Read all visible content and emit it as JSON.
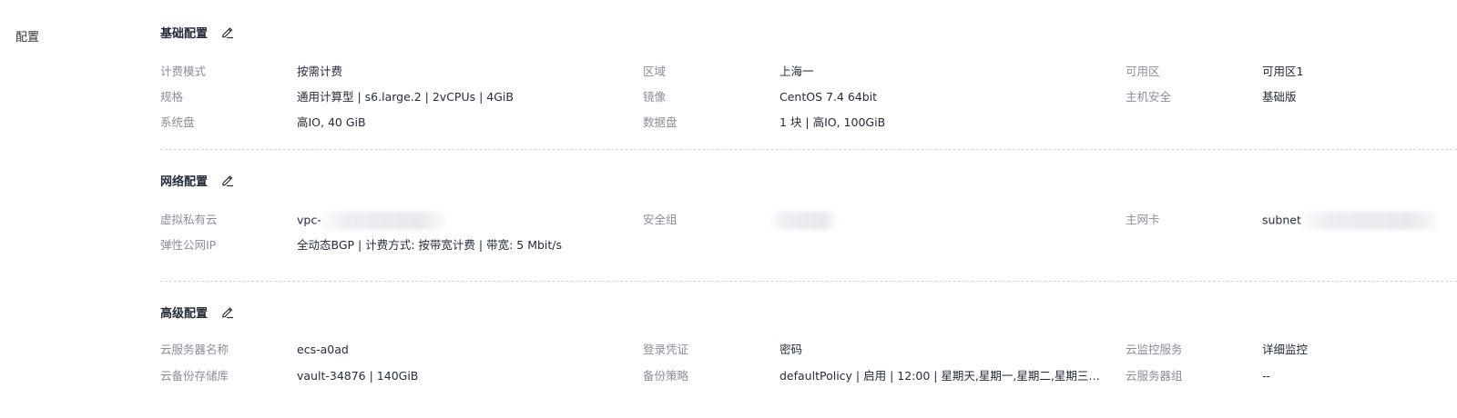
{
  "page_title": "配置",
  "sections": {
    "basic": {
      "title": "基础配置",
      "rows": [
        [
          {
            "label": "计费模式",
            "value": "按需计费"
          },
          {
            "label": "区域",
            "value": "上海一"
          },
          {
            "label": "可用区",
            "value": "可用区1"
          }
        ],
        [
          {
            "label": "规格",
            "value": "通用计算型 | s6.large.2 | 2vCPUs | 4GiB"
          },
          {
            "label": "镜像",
            "value": "CentOS 7.4 64bit"
          },
          {
            "label": "主机安全",
            "value": "基础版"
          }
        ],
        [
          {
            "label": "系统盘",
            "value": "高IO, 40 GiB"
          },
          {
            "label": "数据盘",
            "value": "1 块 | 高IO, 100GiB"
          }
        ]
      ]
    },
    "network": {
      "title": "网络配置",
      "rows": [
        [
          {
            "label": "虚拟私有云",
            "value": "vpc-"
          },
          {
            "label": "安全组",
            "value": ""
          },
          {
            "label": "主网卡",
            "value": "subnet"
          }
        ],
        [
          {
            "label": "弹性公网IP",
            "value": "全动态BGP |  计费方式: 按带宽计费 |  带宽: 5 Mbit/s"
          }
        ]
      ]
    },
    "advanced": {
      "title": "高级配置",
      "rows": [
        [
          {
            "label": "云服务器名称",
            "value": "ecs-a0ad"
          },
          {
            "label": "登录凭证",
            "value": "密码"
          },
          {
            "label": "云监控服务",
            "value": "详细监控"
          }
        ],
        [
          {
            "label": "云备份存储库",
            "value": "vault-34876 | 140GiB"
          },
          {
            "label": "备份策略",
            "value": "defaultPolicy | 启用 | 12:00 | 星期天,星期一,星期二,星期三,星..."
          },
          {
            "label": "云服务器组",
            "value": "--"
          }
        ]
      ]
    }
  },
  "icons": {
    "edit": "edit-icon"
  },
  "colors": {
    "label": "#8a8e99",
    "value": "#252b3a",
    "divider": "#d4d6dc"
  }
}
